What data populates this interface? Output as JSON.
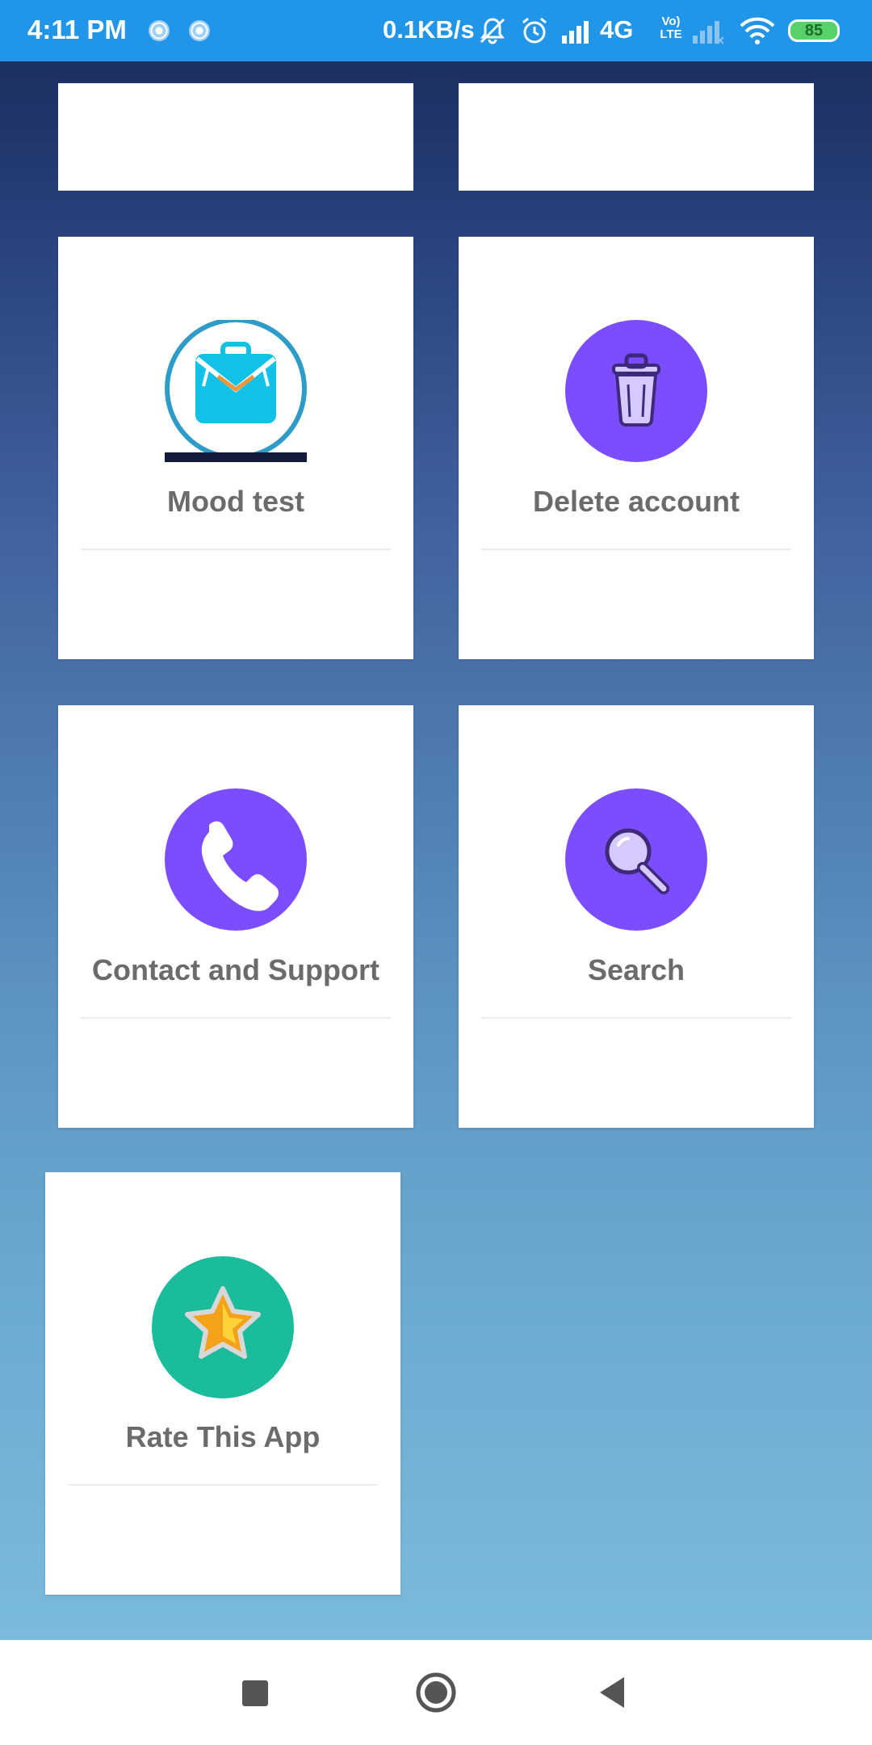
{
  "status_bar": {
    "time": "4:11 PM",
    "net_speed": "0.1KB/s",
    "network": "4G",
    "network_sub": "Vo) LTE",
    "battery": "85",
    "icons": [
      "sync-icon",
      "sync-icon",
      "mute-icon",
      "alarm-icon",
      "signal-icon",
      "signal-icon",
      "wifi-icon",
      "battery-icon"
    ]
  },
  "menu": {
    "items": [
      {
        "label": "Mood test",
        "icon": "mood-mailbag-icon"
      },
      {
        "label": "Delete account",
        "icon": "trash-icon",
        "color": "#7c4dff"
      },
      {
        "label": "Contact and Support",
        "icon": "phone-icon",
        "color": "#7c4dff"
      },
      {
        "label": "Search",
        "icon": "search-icon",
        "color": "#7c4dff"
      },
      {
        "label": "Rate This App",
        "icon": "star-icon",
        "color": "#1abc9c"
      }
    ]
  },
  "nav": {
    "buttons": [
      "recents-square-icon",
      "home-circle-icon",
      "back-triangle-icon"
    ]
  }
}
